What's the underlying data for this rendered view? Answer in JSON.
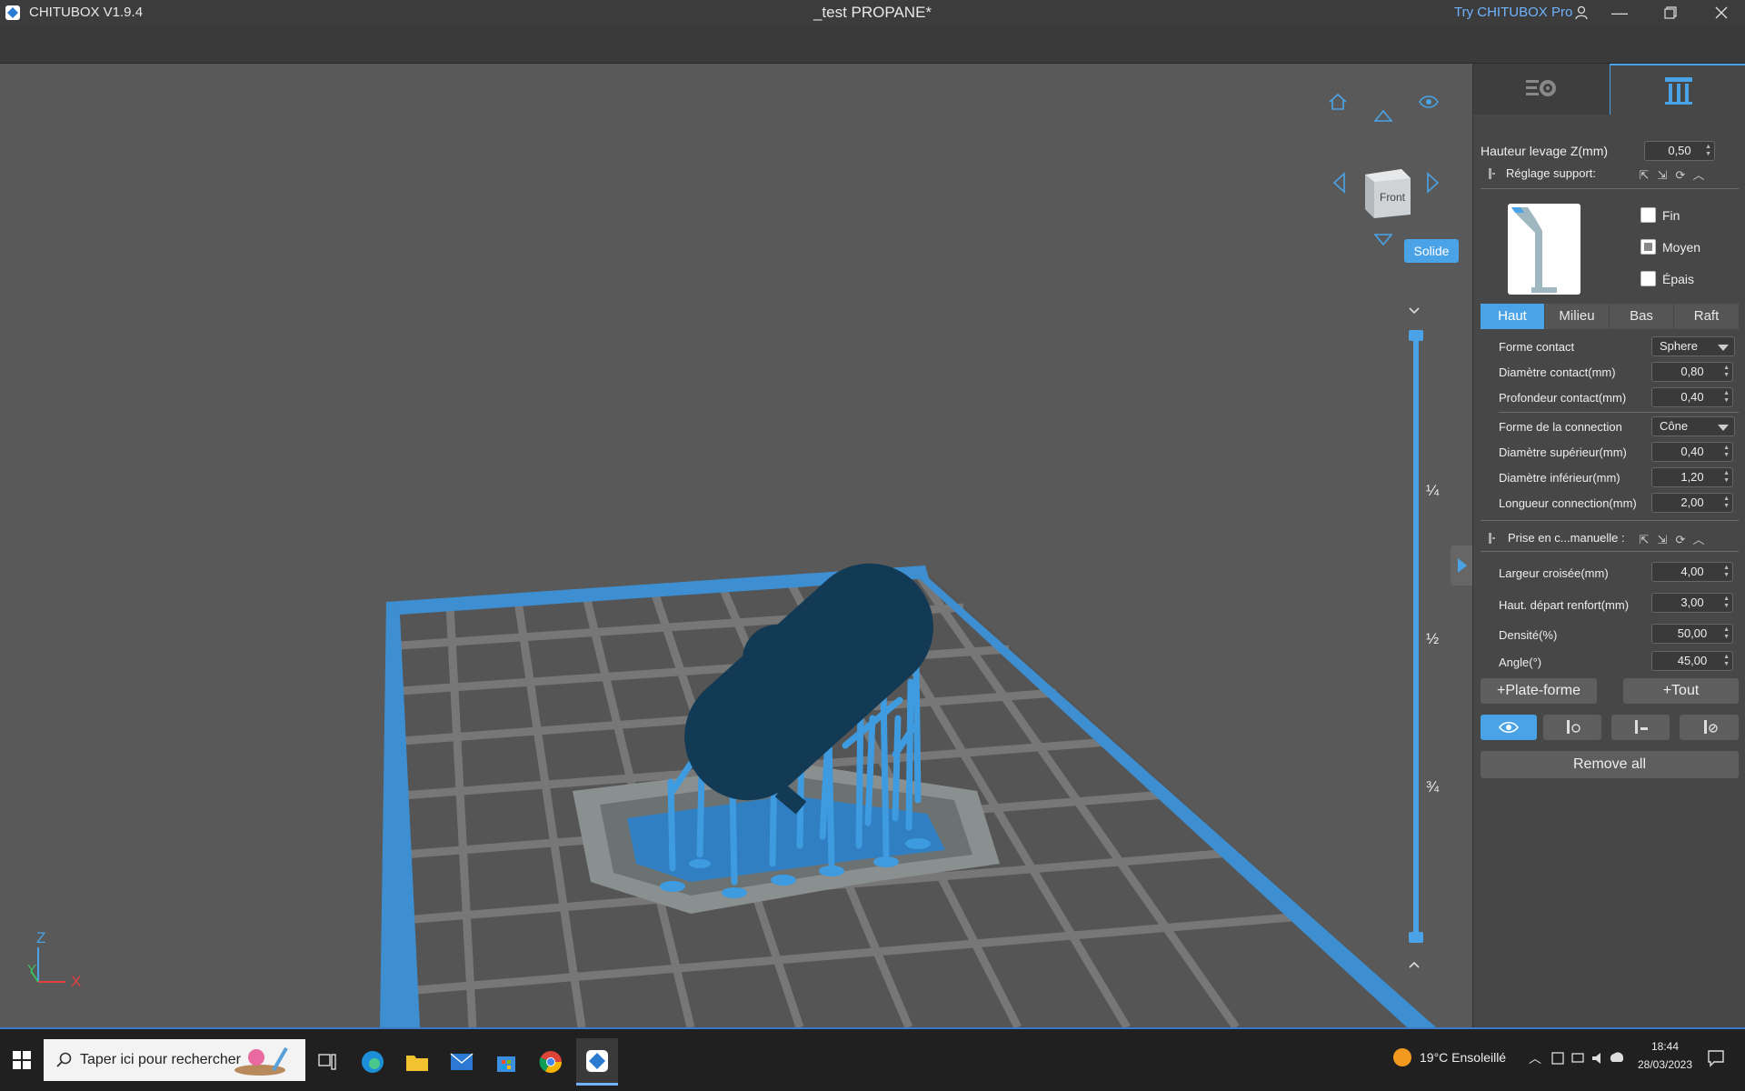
{
  "titlebar": {
    "app_title": "CHITUBOX V1.9.4",
    "document_title": "_test PROPANE*",
    "try_pro": "Try CHITUBOX Pro"
  },
  "viewport": {
    "view_cube_label": "Front",
    "solid_button": "Solide",
    "slider_marks": [
      "¼",
      "½",
      "¾"
    ],
    "axes": {
      "z": "Z",
      "y": "Y",
      "x": "X"
    }
  },
  "panel": {
    "lift_height": {
      "label": "Hauteur levage Z(mm)",
      "value": "0,50"
    },
    "support_settings": {
      "label": "Réglage support:"
    },
    "density_options": [
      {
        "label": "Fin",
        "checked": false
      },
      {
        "label": "Moyen",
        "checked": "partial"
      },
      {
        "label": "Épais",
        "checked": false
      }
    ],
    "subtabs": [
      "Haut",
      "Milieu",
      "Bas",
      "Raft"
    ],
    "active_subtab": "Haut",
    "top_params": [
      {
        "label": "Forme contact",
        "type": "select",
        "value": "Sphere"
      },
      {
        "label": "Diamètre contact(mm)",
        "type": "number",
        "value": "0,80"
      },
      {
        "label": "Profondeur contact(mm)",
        "type": "number",
        "value": "0,40"
      },
      {
        "label": "Forme de la connection",
        "type": "select",
        "value": "Cône"
      },
      {
        "label": "Diamètre supérieur(mm)",
        "type": "number",
        "value": "0,40"
      },
      {
        "label": "Diamètre inférieur(mm)",
        "type": "number",
        "value": "1,20"
      },
      {
        "label": "Longueur connection(mm)",
        "type": "number",
        "value": "2,00"
      }
    ],
    "manual_support": {
      "label": "Prise en c...manuelle :"
    },
    "manual_params": [
      {
        "label": "Largeur croisée(mm)",
        "value": "4,00"
      },
      {
        "label": "Haut. départ renfort(mm)",
        "value": "3,00"
      },
      {
        "label": "Densité(%)",
        "value": "50,00"
      },
      {
        "label": "Angle(°)",
        "value": "45,00"
      }
    ],
    "add_platform_button": "+Plate-forme",
    "add_all_button": "+Tout",
    "remove_all_button": "Remove all"
  },
  "taskbar": {
    "search_placeholder": "Taper ici pour rechercher",
    "weather": "19°C  Ensoleillé",
    "time": "18:44",
    "date": "28/03/2023"
  },
  "colors": {
    "accent": "#4aa3e6",
    "model": "#123a55",
    "supports": "#3e9be0",
    "build_frame": "#3d8fd1"
  }
}
